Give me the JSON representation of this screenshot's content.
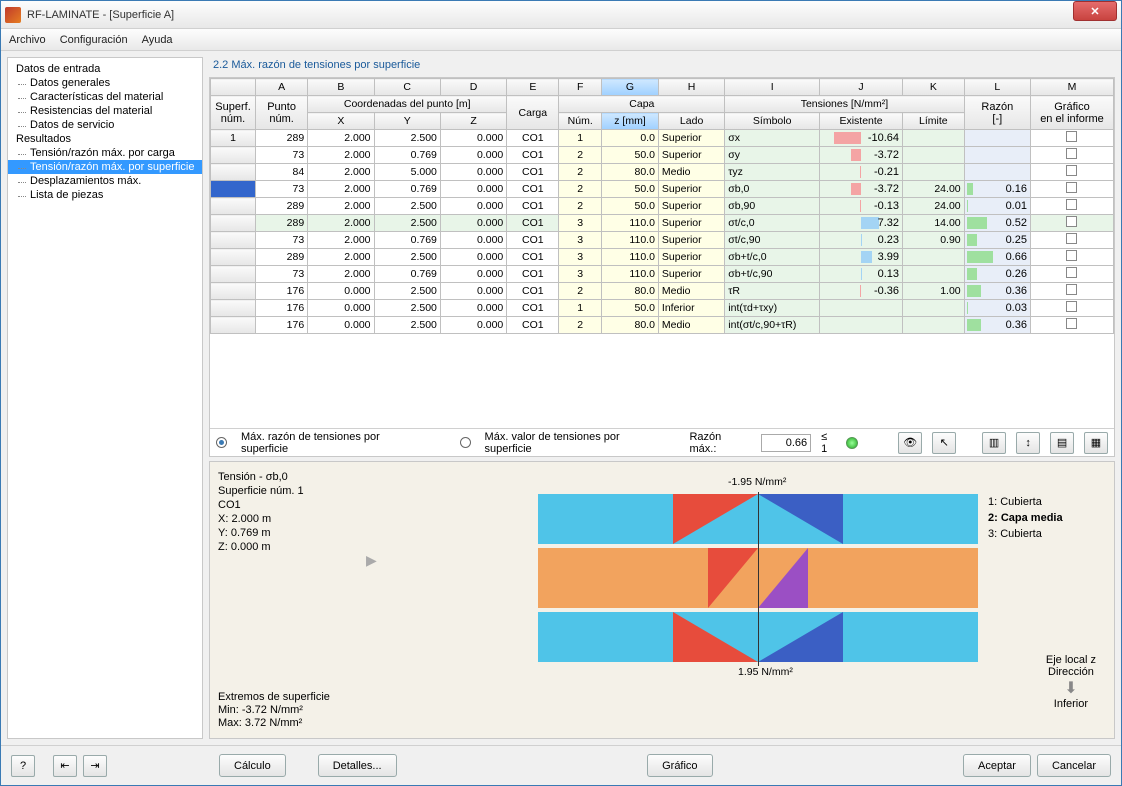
{
  "window": {
    "title": "RF-LAMINATE - [Superficie A]"
  },
  "menu": {
    "file": "Archivo",
    "config": "Configuración",
    "help": "Ayuda"
  },
  "sidebar": {
    "entry_hdr": "Datos de entrada",
    "items_in": [
      "Datos generales",
      "Características del material",
      "Resistencias del material",
      "Datos de servicio"
    ],
    "results_hdr": "Resultados",
    "items_res": [
      "Tensión/razón máx. por carga",
      "Tensión/razón máx. por superficie",
      "Desplazamientos máx.",
      "Lista de piezas"
    ]
  },
  "main": {
    "header": "2.2 Máx. razón de tensiones por superficie",
    "col_letters": [
      "A",
      "B",
      "C",
      "D",
      "E",
      "F",
      "G",
      "H",
      "I",
      "J",
      "K",
      "L",
      "M"
    ],
    "group_superf": "Superf.\nnúm.",
    "group_punto": "Punto\nnúm.",
    "group_coord": "Coordenadas del punto [m]",
    "coord_x": "X",
    "coord_y": "Y",
    "coord_z": "Z",
    "group_carga": "Carga",
    "group_capa": "Capa",
    "capa_num": "Núm.",
    "capa_z": "z [mm]",
    "capa_lado": "Lado",
    "group_tens": "Tensiones [N/mm²]",
    "tens_sym": "Símbolo",
    "tens_ex": "Existente",
    "tens_lim": "Límite",
    "group_razon": "Razón\n[-]",
    "group_graf": "Gráfico\nen el informe",
    "rows": [
      {
        "surf": "1",
        "pt": "289",
        "x": "2.000",
        "y": "2.500",
        "z": "0.000",
        "cg": "CO1",
        "cn": "1",
        "cz": "0.0",
        "ld": "Superior",
        "sym": "σx",
        "ex": "-10.64",
        "lim": "",
        "rz": "",
        "bar": -0.9
      },
      {
        "surf": "",
        "pt": "73",
        "x": "2.000",
        "y": "0.769",
        "z": "0.000",
        "cg": "CO1",
        "cn": "2",
        "cz": "50.0",
        "ld": "Superior",
        "sym": "σy",
        "ex": "-3.72",
        "lim": "",
        "rz": "",
        "bar": -0.35
      },
      {
        "surf": "",
        "pt": "84",
        "x": "2.000",
        "y": "5.000",
        "z": "0.000",
        "cg": "CO1",
        "cn": "2",
        "cz": "80.0",
        "ld": "Medio",
        "sym": "τyz",
        "ex": "-0.21",
        "lim": "",
        "rz": "",
        "bar": -0.03
      },
      {
        "surf": "",
        "pt": "73",
        "x": "2.000",
        "y": "0.769",
        "z": "0.000",
        "cg": "CO1",
        "cn": "2",
        "cz": "50.0",
        "ld": "Superior",
        "sym": "σb,0",
        "ex": "-3.72",
        "lim": "24.00",
        "rz": "0.16",
        "bar": -0.35,
        "sel": true
      },
      {
        "surf": "",
        "pt": "289",
        "x": "2.000",
        "y": "2.500",
        "z": "0.000",
        "cg": "CO1",
        "cn": "2",
        "cz": "50.0",
        "ld": "Superior",
        "sym": "σb,90",
        "ex": "-0.13",
        "lim": "24.00",
        "rz": "0.01",
        "bar": -0.02
      },
      {
        "surf": "",
        "pt": "289",
        "x": "2.000",
        "y": "2.500",
        "z": "0.000",
        "cg": "CO1",
        "cn": "3",
        "cz": "110.0",
        "ld": "Superior",
        "sym": "σt/c,0",
        "ex": "7.32",
        "lim": "14.00",
        "rz": "0.52",
        "bar": 0.6,
        "hl": true
      },
      {
        "surf": "",
        "pt": "73",
        "x": "2.000",
        "y": "0.769",
        "z": "0.000",
        "cg": "CO1",
        "cn": "3",
        "cz": "110.0",
        "ld": "Superior",
        "sym": "σt/c,90",
        "ex": "0.23",
        "lim": "0.90",
        "rz": "0.25",
        "bar": 0.03
      },
      {
        "surf": "",
        "pt": "289",
        "x": "2.000",
        "y": "2.500",
        "z": "0.000",
        "cg": "CO1",
        "cn": "3",
        "cz": "110.0",
        "ld": "Superior",
        "sym": "σb+t/c,0",
        "ex": "3.99",
        "lim": "",
        "rz": "0.66",
        "bar": 0.35
      },
      {
        "surf": "",
        "pt": "73",
        "x": "2.000",
        "y": "0.769",
        "z": "0.000",
        "cg": "CO1",
        "cn": "3",
        "cz": "110.0",
        "ld": "Superior",
        "sym": "σb+t/c,90",
        "ex": "0.13",
        "lim": "",
        "rz": "0.26",
        "bar": 0.02
      },
      {
        "surf": "",
        "pt": "176",
        "x": "0.000",
        "y": "2.500",
        "z": "0.000",
        "cg": "CO1",
        "cn": "2",
        "cz": "80.0",
        "ld": "Medio",
        "sym": "τR",
        "ex": "-0.36",
        "lim": "1.00",
        "rz": "0.36",
        "bar": -0.04
      },
      {
        "surf": "",
        "pt": "176",
        "x": "0.000",
        "y": "2.500",
        "z": "0.000",
        "cg": "CO1",
        "cn": "1",
        "cz": "50.0",
        "ld": "Inferior",
        "sym": "int(τd+τxy)",
        "ex": "",
        "lim": "",
        "rz": "0.03",
        "bar": 0
      },
      {
        "surf": "",
        "pt": "176",
        "x": "0.000",
        "y": "2.500",
        "z": "0.000",
        "cg": "CO1",
        "cn": "2",
        "cz": "80.0",
        "ld": "Medio",
        "sym": "int(σt/c,90+τR)",
        "ex": "",
        "lim": "",
        "rz": "0.36",
        "bar": 0
      }
    ],
    "opt1": "Máx. razón de tensiones por superficie",
    "opt2": "Máx. valor de tensiones por superficie",
    "razon_lbl": "Razón máx.:",
    "razon_val": "0.66",
    "razon_lim": "≤ 1"
  },
  "diagram": {
    "title": "Tensión - σb,0",
    "surf": "Superficie núm. 1",
    "co": "CO1",
    "x": "X: 2.000  m",
    "y": "Y: 0.769  m",
    "z": "Z: 0.000 m",
    "top_val": "-1.95 N/mm²",
    "bot_val": "1.95 N/mm²",
    "layers": [
      "1: Cubierta",
      "2: Capa media",
      "3: Cubierta"
    ],
    "ext_hdr": "Extremos de superficie",
    "ext_min": "Min: -3.72 N/mm²",
    "ext_max": "Max:  3.72 N/mm²",
    "axis": "Eje local z\nDirección",
    "inf": "Inferior"
  },
  "footer": {
    "calc": "Cálculo",
    "details": "Detalles...",
    "graf": "Gráfico",
    "ok": "Aceptar",
    "cancel": "Cancelar"
  }
}
